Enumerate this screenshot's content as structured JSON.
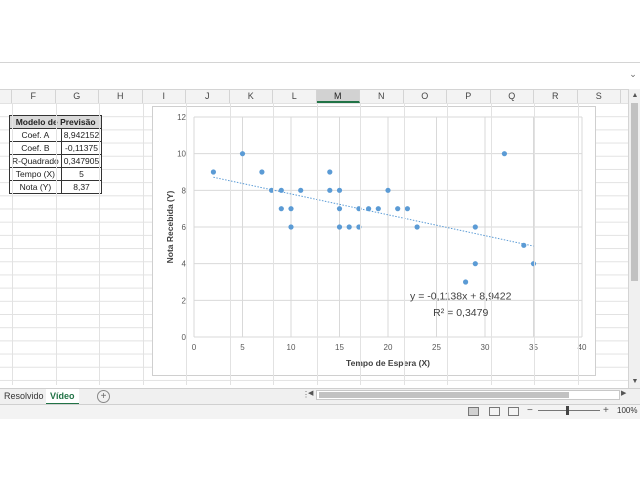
{
  "sheet": {
    "columns": [
      "F",
      "G",
      "H",
      "I",
      "J",
      "K",
      "L",
      "M",
      "N",
      "O",
      "P",
      "Q",
      "R",
      "S"
    ],
    "selected_column": "M",
    "tabs": [
      {
        "label": "Resolvido",
        "active": false
      },
      {
        "label": "Vídeo",
        "active": true
      }
    ],
    "add_sheet_label": "+"
  },
  "table": {
    "header": "Modelo de Previsão",
    "rows": [
      {
        "label": "Coef. A",
        "value": "8,942152"
      },
      {
        "label": "Coef. B",
        "value": "-0,11375"
      },
      {
        "label": "R-Quadrado",
        "value": "0,347905"
      },
      {
        "label": "Tempo (X)",
        "value": "5"
      },
      {
        "label": "Nota (Y)",
        "value": "8,37"
      }
    ]
  },
  "chart_data": {
    "type": "scatter",
    "xlabel": "Tempo de Espera (X)",
    "ylabel": "Nota Recebida (Y)",
    "xlim": [
      0,
      40
    ],
    "ylim": [
      0,
      12
    ],
    "xticks": [
      "0",
      "5",
      "10",
      "15",
      "20",
      "25",
      "30",
      "35",
      "40"
    ],
    "yticks": [
      "0",
      "2",
      "4",
      "6",
      "8",
      "10",
      "12"
    ],
    "grid": true,
    "marker_color": "#5B9BD5",
    "trendline": {
      "slope": -0.1138,
      "intercept": 8.9422,
      "from": 2,
      "to": 35,
      "color": "#5B9BD5"
    },
    "equation": "y = -0,1138x + 8,9422",
    "r_squared": "R² = 0,3479",
    "points": [
      [
        2,
        9
      ],
      [
        5,
        10
      ],
      [
        7,
        9
      ],
      [
        8,
        8
      ],
      [
        9,
        8
      ],
      [
        9,
        7
      ],
      [
        10,
        7
      ],
      [
        10,
        6
      ],
      [
        11,
        8
      ],
      [
        14,
        9
      ],
      [
        14,
        8
      ],
      [
        15,
        8
      ],
      [
        15,
        7
      ],
      [
        15,
        6
      ],
      [
        16,
        6
      ],
      [
        17,
        7
      ],
      [
        17,
        6
      ],
      [
        18,
        7
      ],
      [
        19,
        7
      ],
      [
        20,
        8
      ],
      [
        21,
        7
      ],
      [
        22,
        7
      ],
      [
        23,
        6
      ],
      [
        28,
        3
      ],
      [
        29,
        6
      ],
      [
        29,
        4
      ],
      [
        32,
        10
      ],
      [
        34,
        5
      ],
      [
        35,
        4
      ]
    ]
  },
  "status": {
    "zoom": "100%",
    "zoom_minus": "−",
    "zoom_plus": "+"
  }
}
